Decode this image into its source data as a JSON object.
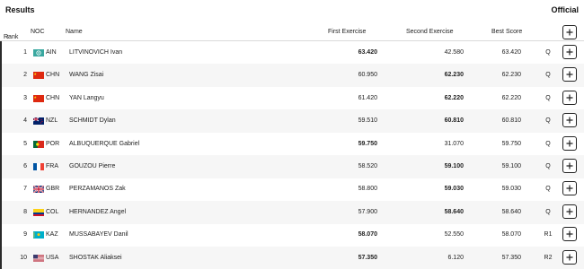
{
  "page": {
    "title": "Results",
    "status": "Official"
  },
  "columns": {
    "rank": "Rank",
    "sort_arrow": "↑",
    "noc": "NOC",
    "name": "Name",
    "first": "First Exercise",
    "second": "Second Exercise",
    "best": "Best Score"
  },
  "colors": {
    "accent": "#2a2a2a",
    "row_alt": "#f6f6f6",
    "divider": "#d9d9d9"
  },
  "icons": {
    "expand": "plus-icon",
    "sort": "arrow-up-icon"
  },
  "rows": [
    {
      "rank": "1",
      "flag": "flag-ain",
      "noc": "AIN",
      "name": "LITVINOVICH Ivan",
      "first": "63.420",
      "second": "42.580",
      "best": "63.420",
      "q": "Q",
      "first_bold": true,
      "second_bold": false
    },
    {
      "rank": "2",
      "flag": "flag-chn",
      "noc": "CHN",
      "name": "WANG Zisai",
      "first": "60.950",
      "second": "62.230",
      "best": "62.230",
      "q": "Q",
      "first_bold": false,
      "second_bold": true
    },
    {
      "rank": "3",
      "flag": "flag-chn",
      "noc": "CHN",
      "name": "YAN Langyu",
      "first": "61.420",
      "second": "62.220",
      "best": "62.220",
      "q": "Q",
      "first_bold": false,
      "second_bold": true
    },
    {
      "rank": "4",
      "flag": "flag-nzl",
      "noc": "NZL",
      "name": "SCHMIDT Dylan",
      "first": "59.510",
      "second": "60.810",
      "best": "60.810",
      "q": "Q",
      "first_bold": false,
      "second_bold": true
    },
    {
      "rank": "5",
      "flag": "flag-por",
      "noc": "POR",
      "name": "ALBUQUERQUE Gabriel",
      "first": "59.750",
      "second": "31.070",
      "best": "59.750",
      "q": "Q",
      "first_bold": true,
      "second_bold": false
    },
    {
      "rank": "6",
      "flag": "flag-fra",
      "noc": "FRA",
      "name": "GOUZOU Pierre",
      "first": "58.520",
      "second": "59.100",
      "best": "59.100",
      "q": "Q",
      "first_bold": false,
      "second_bold": true
    },
    {
      "rank": "7",
      "flag": "flag-gbr",
      "noc": "GBR",
      "name": "PERZAMANOS Zak",
      "first": "58.800",
      "second": "59.030",
      "best": "59.030",
      "q": "Q",
      "first_bold": false,
      "second_bold": true
    },
    {
      "rank": "8",
      "flag": "flag-col",
      "noc": "COL",
      "name": "HERNANDEZ Angel",
      "first": "57.900",
      "second": "58.640",
      "best": "58.640",
      "q": "Q",
      "first_bold": false,
      "second_bold": true
    },
    {
      "rank": "9",
      "flag": "flag-kaz",
      "noc": "KAZ",
      "name": "MUSSABAYEV Danil",
      "first": "58.070",
      "second": "52.550",
      "best": "58.070",
      "q": "R1",
      "first_bold": true,
      "second_bold": false
    },
    {
      "rank": "10",
      "flag": "flag-usa",
      "noc": "USA",
      "name": "SHOSTAK Aliaksei",
      "first": "57.350",
      "second": "6.120",
      "best": "57.350",
      "q": "R2",
      "first_bold": true,
      "second_bold": false
    }
  ]
}
